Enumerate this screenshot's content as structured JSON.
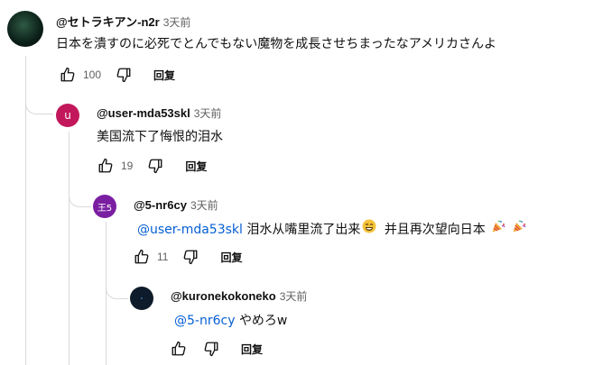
{
  "comments": [
    {
      "author": "@セトラキアン-n2r",
      "time": "3天前",
      "text": "日本を潰すのに必死でとんでもない魔物を成長させちまったなアメリカさんよ",
      "likes": "100",
      "reply": "回复",
      "avatar": {
        "color": "#0b1f18",
        "letter": ""
      }
    },
    {
      "author": "@user-mda53skl",
      "time": "3天前",
      "text": "美国流下了悔恨的泪水",
      "likes": "19",
      "reply": "回复",
      "avatar": {
        "color": "#c2185b",
        "letter": "u"
      }
    },
    {
      "author": "@5-nr6cy",
      "time": "3天前",
      "mention": "@user-mda53skl",
      "text": "泪水从嘴里流了出来",
      "text2": "并且再次望向日本",
      "likes": "11",
      "reply": "回复",
      "avatar": {
        "color": "#7b1fa2",
        "letter": "王5"
      }
    },
    {
      "author": "@kuronekokoneko",
      "time": "3天前",
      "mention": "@5-nr6cy",
      "text": "やめろw",
      "likes": "",
      "reply": "回复",
      "avatar": {
        "color": "#0d1b2a",
        "letter": ""
      }
    }
  ],
  "colors": {
    "mention": "#065fd4",
    "thread": "#d9d9d9"
  },
  "icons": [
    "like-icon",
    "dislike-icon",
    "laughing-emoji-icon",
    "party-popper-icon"
  ]
}
